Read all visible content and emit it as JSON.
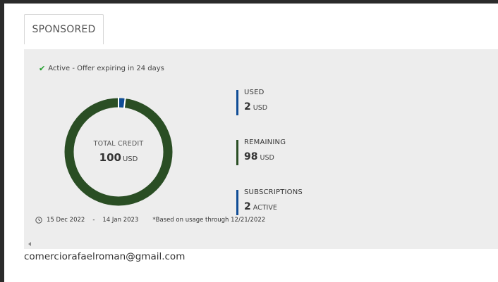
{
  "tab": {
    "label": "SPONSORED"
  },
  "status": {
    "text": "Active - Offer expiring in 24 days"
  },
  "donut": {
    "label": "TOTAL CREDIT",
    "value": "100",
    "unit": "USD",
    "used_fraction": 0.02,
    "colors": {
      "used": "#0f4c96",
      "remaining": "#2a4e24"
    }
  },
  "metrics": [
    {
      "label": "USED",
      "value": "2",
      "unit": "USD",
      "color": "#0f4c96"
    },
    {
      "label": "REMAINING",
      "value": "98",
      "unit": "USD",
      "color": "#2a4e24"
    },
    {
      "label": "SUBSCRIPTIONS",
      "value": "2",
      "unit": "ACTIVE",
      "color": "#0f4c96"
    }
  ],
  "period": {
    "start": "15 Dec 2022",
    "separator": "-",
    "end": "14 Jan 2023",
    "note": "*Based on usage through 12/21/2022"
  },
  "account": {
    "email": "comerciorafaelroman@gmail.com"
  }
}
